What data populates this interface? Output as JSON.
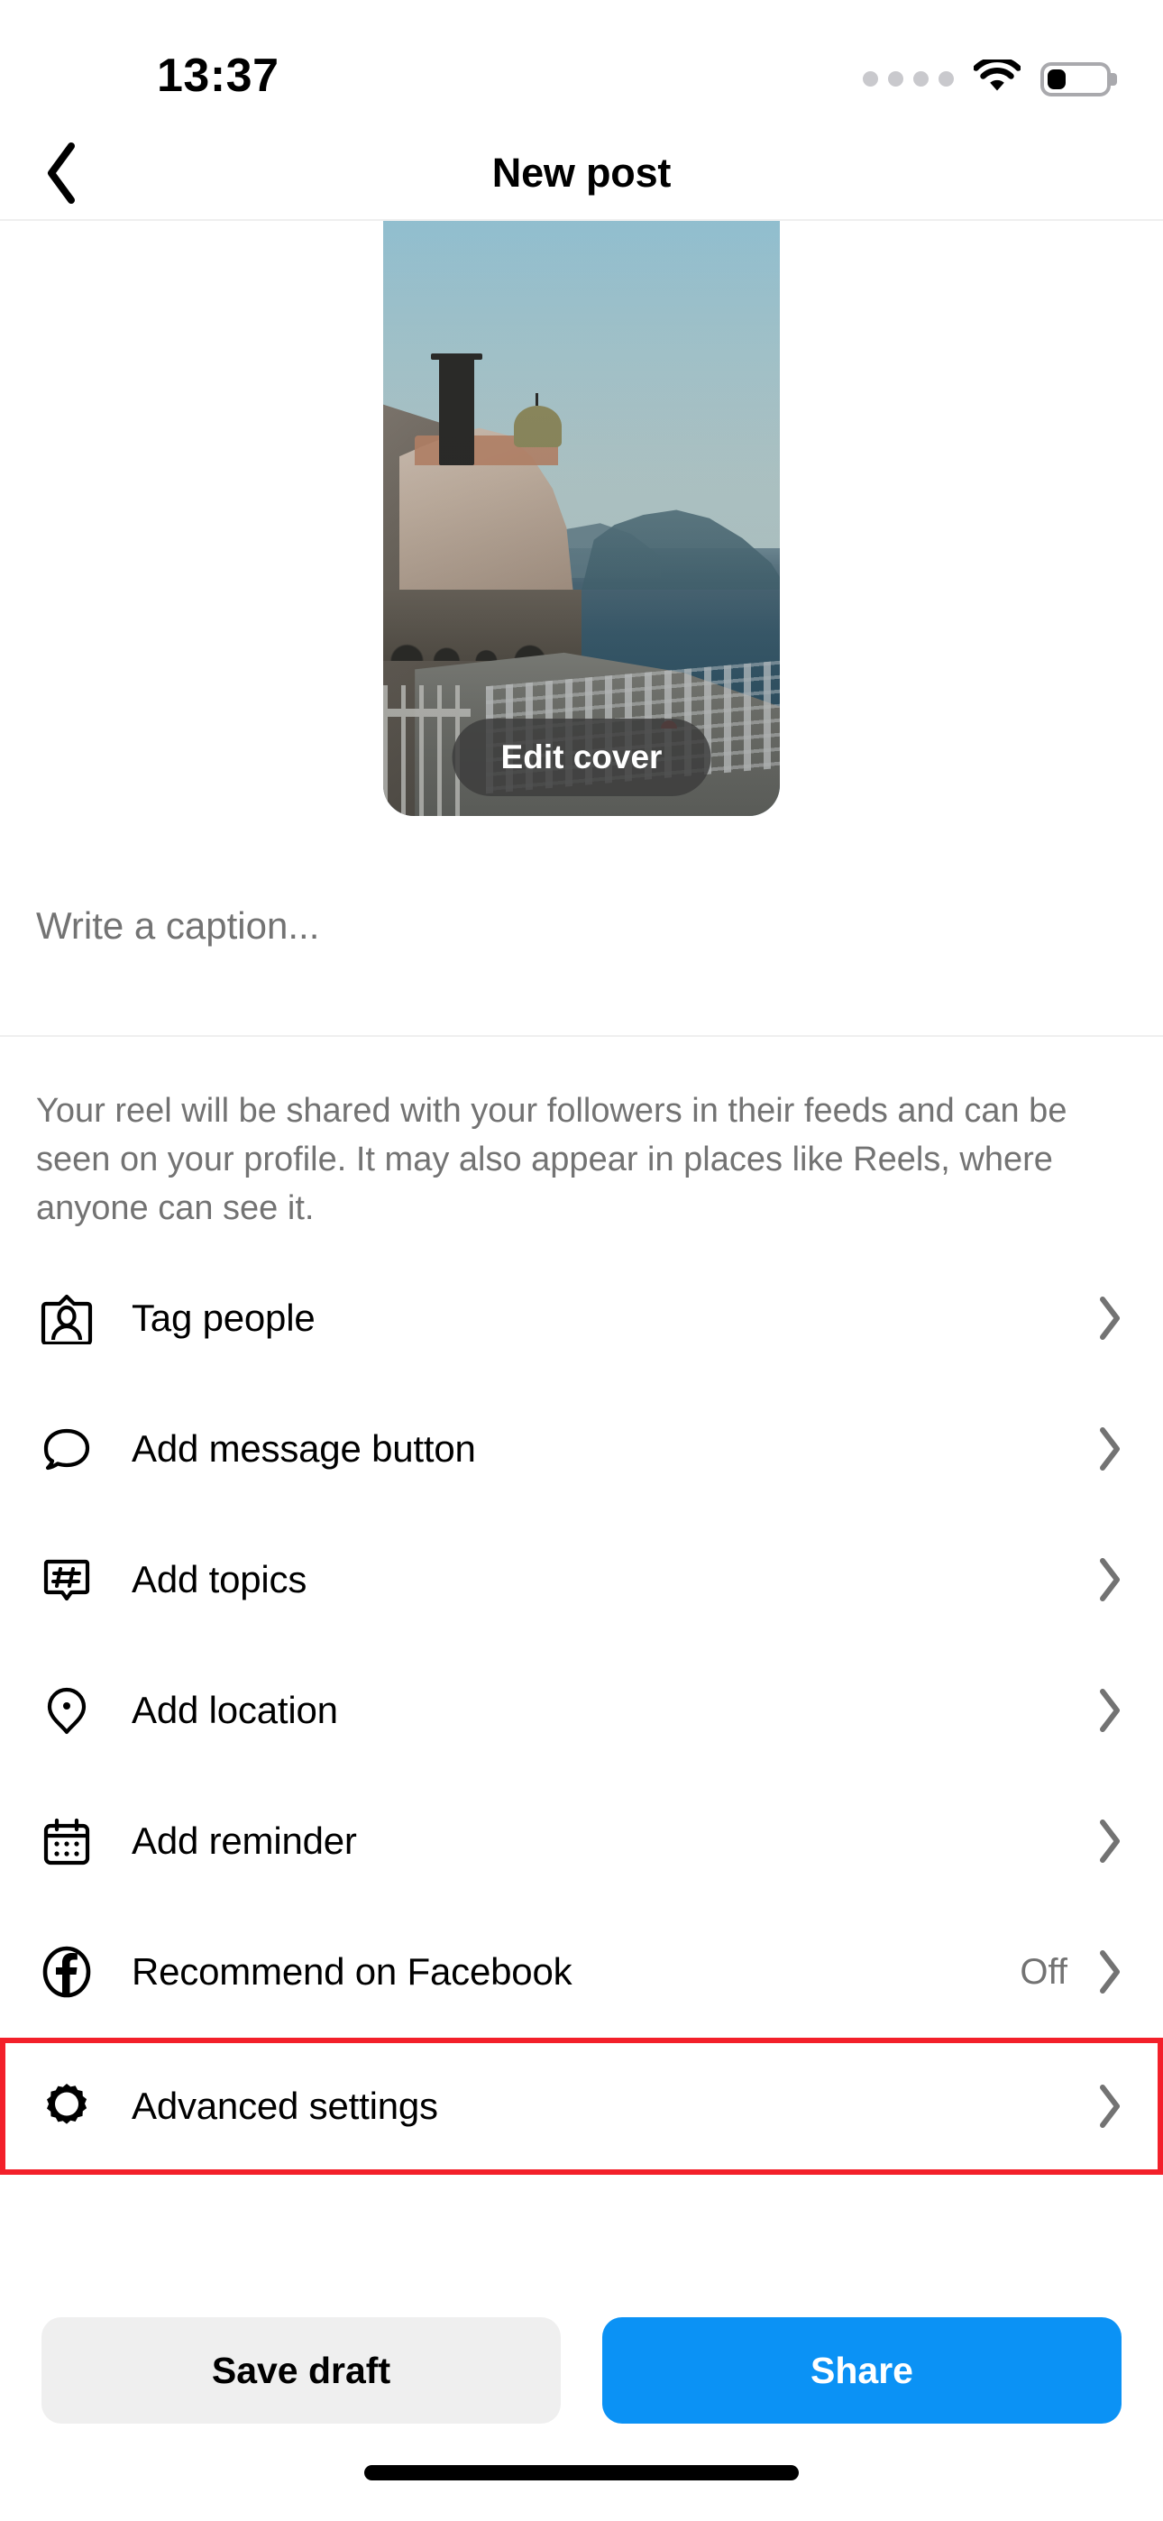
{
  "status_bar": {
    "time": "13:37",
    "signal_icon": "signal-dots-icon",
    "wifi_icon": "wifi-icon",
    "battery_icon": "battery-icon",
    "battery_level_percent": 33
  },
  "header": {
    "back_icon": "chevron-left-icon",
    "title": "New post"
  },
  "cover": {
    "edit_cover_label": "Edit cover",
    "alt": "coastal town with church, sea and beach umbrellas"
  },
  "caption": {
    "value": "",
    "placeholder": "Write a caption..."
  },
  "description": "Your reel will be shared with your followers in their feeds and can be seen on your profile. It may also appear in places like Reels, where anyone can see it.",
  "options": [
    {
      "label": "Tag people",
      "icon": "tag-people-icon",
      "value": "",
      "chevron": "chevron-right-icon",
      "highlighted": false
    },
    {
      "label": "Add message button",
      "icon": "message-bubble-icon",
      "value": "",
      "chevron": "chevron-right-icon",
      "highlighted": false
    },
    {
      "label": "Add topics",
      "icon": "hashtag-icon",
      "value": "",
      "chevron": "chevron-right-icon",
      "highlighted": false
    },
    {
      "label": "Add location",
      "icon": "location-pin-icon",
      "value": "",
      "chevron": "chevron-right-icon",
      "highlighted": false
    },
    {
      "label": "Add reminder",
      "icon": "calendar-icon",
      "value": "",
      "chevron": "chevron-right-icon",
      "highlighted": false
    },
    {
      "label": "Recommend on Facebook",
      "icon": "facebook-icon",
      "value": "Off",
      "chevron": "chevron-right-icon",
      "highlighted": false
    },
    {
      "label": "Advanced settings",
      "icon": "gear-icon",
      "value": "",
      "chevron": "chevron-right-icon",
      "highlighted": true
    }
  ],
  "footer": {
    "save_draft_label": "Save draft",
    "share_label": "Share"
  },
  "colors": {
    "accent_blue": "#0b92f5",
    "highlight_red": "#f3202a",
    "secondary_grey": "#efefef",
    "muted_text": "#737373"
  }
}
